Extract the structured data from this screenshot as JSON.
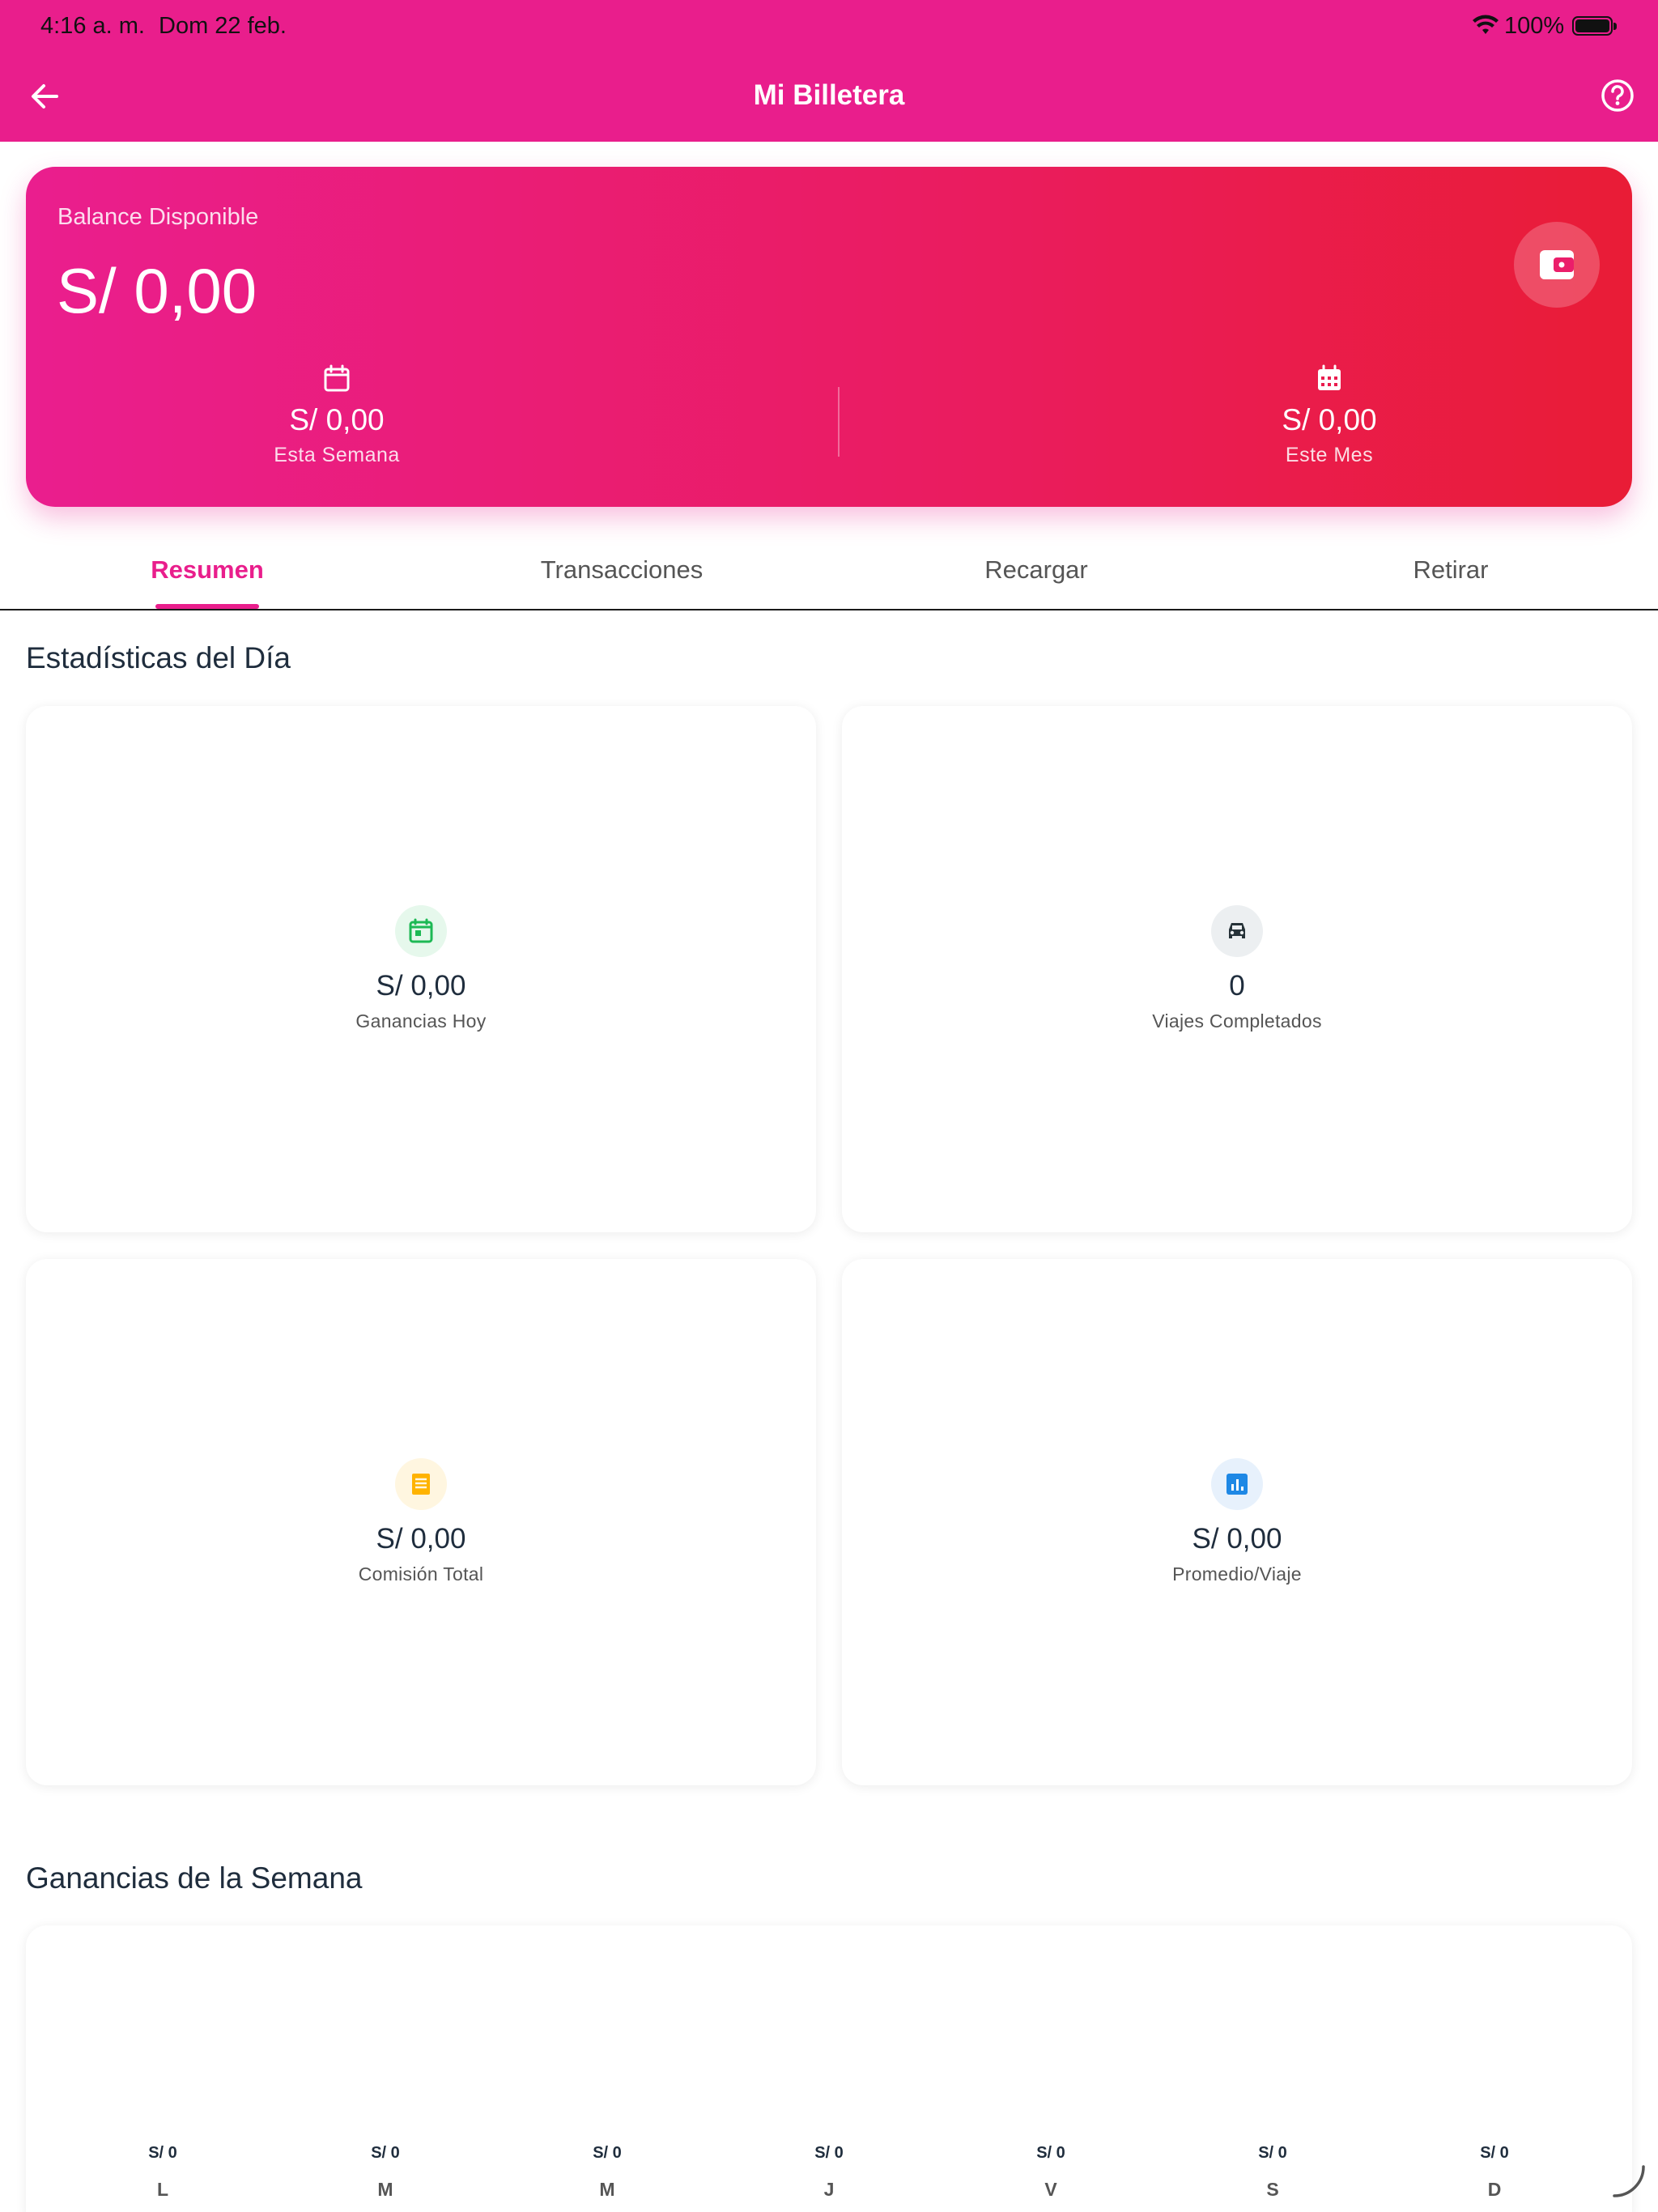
{
  "status_bar": {
    "time": "4:16 a. m.",
    "date": "Dom 22 feb.",
    "battery": "100%"
  },
  "app_bar": {
    "title": "Mi Billetera"
  },
  "balance": {
    "label": "Balance Disponible",
    "amount": "S/ 0,00",
    "week": {
      "value": "S/ 0,00",
      "caption": "Esta Semana"
    },
    "month": {
      "value": "S/ 0,00",
      "caption": "Este Mes"
    }
  },
  "tabs": [
    {
      "label": "Resumen",
      "active": true
    },
    {
      "label": "Transacciones",
      "active": false
    },
    {
      "label": "Recargar",
      "active": false
    },
    {
      "label": "Retirar",
      "active": false
    }
  ],
  "daily_stats": {
    "title": "Estadísticas del Día",
    "cards": [
      {
        "value": "S/ 0,00",
        "caption": "Ganancias Hoy",
        "icon": "calendar-today-icon",
        "color": "#1DB954"
      },
      {
        "value": "0",
        "caption": "Viajes Completados",
        "icon": "car-icon",
        "color": "#37474F"
      },
      {
        "value": "S/ 0,00",
        "caption": "Comisión Total",
        "icon": "receipt-icon",
        "color": "#FFB300"
      },
      {
        "value": "S/ 0,00",
        "caption": "Promedio/Viaje",
        "icon": "analytics-icon",
        "color": "#1E88E5"
      }
    ]
  },
  "weekly": {
    "title": "Ganancias de la Semana",
    "days": [
      {
        "day": "L",
        "value": "S/ 0"
      },
      {
        "day": "M",
        "value": "S/ 0"
      },
      {
        "day": "M",
        "value": "S/ 0"
      },
      {
        "day": "J",
        "value": "S/ 0"
      },
      {
        "day": "V",
        "value": "S/ 0"
      },
      {
        "day": "S",
        "value": "S/ 0"
      },
      {
        "day": "D",
        "value": "S/ 0"
      }
    ]
  },
  "colors": {
    "primary": "#E91E8C",
    "card_gradient_end": "#E91C36",
    "text_dark": "#1F2D3D"
  }
}
